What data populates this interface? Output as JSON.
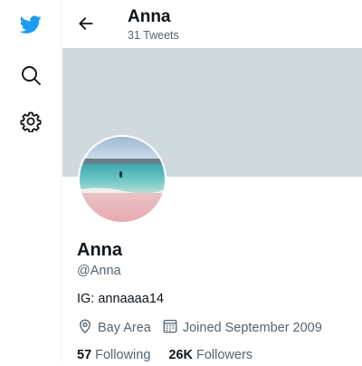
{
  "brand": {
    "color": "#1d9bf0",
    "logo_icon": "twitter-bird-icon"
  },
  "sidebar": {
    "items": [
      {
        "icon": "search-icon"
      },
      {
        "icon": "gear-icon"
      }
    ]
  },
  "header": {
    "back_icon": "arrow-left-icon",
    "title": "Anna",
    "subtitle": "31 Tweets"
  },
  "banner": {
    "color": "#cfd9de"
  },
  "profile": {
    "name": "Anna",
    "handle": "@Anna",
    "bio": "IG: annaaaa14",
    "location": "Bay Area",
    "joined": "Joined September 2009",
    "following_count": "57",
    "following_label": "Following",
    "followers_count": "26K",
    "followers_label": "Followers"
  }
}
